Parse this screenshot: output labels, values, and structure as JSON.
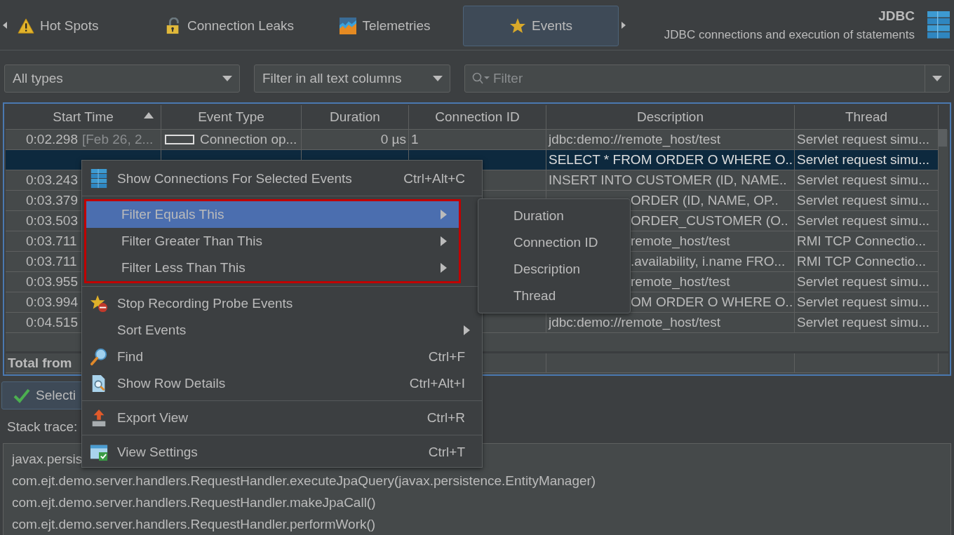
{
  "tabs": [
    {
      "label": "Hot Spots",
      "selected": false
    },
    {
      "label": "Connection Leaks",
      "selected": false
    },
    {
      "label": "Telemetries",
      "selected": false
    },
    {
      "label": "Events",
      "selected": true
    }
  ],
  "header": {
    "title": "JDBC",
    "subtitle": "JDBC connections and execution of statements"
  },
  "filters": {
    "type_dropdown": "All types",
    "column_dropdown": "Filter in all text columns",
    "search": {
      "placeholder": "Filter"
    }
  },
  "table": {
    "columns": [
      {
        "label": "Start Time",
        "sorted": true
      },
      {
        "label": "Event Type",
        "sorted": false
      },
      {
        "label": "Duration",
        "sorted": false
      },
      {
        "label": "Connection ID",
        "sorted": false
      },
      {
        "label": "Description",
        "sorted": false
      },
      {
        "label": "Thread",
        "sorted": false
      }
    ],
    "rows": [
      {
        "start": "0:02.298",
        "date": "[Feb 26, 2...",
        "type": "Connection op...",
        "duration": "0 µs",
        "connection": "1",
        "description": "jdbc:demo://remote_host/test",
        "thread": "Servlet request simu...",
        "selected": false
      },
      {
        "description": "SELECT * FROM ORDER O WHERE O..",
        "thread": "Servlet request simu...",
        "selected": true
      },
      {
        "start": "0:03.243",
        "description": "INSERT INTO CUSTOMER (ID, NAME..",
        "thread": "Servlet request simu...",
        "selected": false
      },
      {
        "start": "0:03.379",
        "description": "ORDER (ID, NAME, OP..",
        "description_covered": true,
        "thread": "Servlet request simu...",
        "selected": false
      },
      {
        "start": "0:03.503",
        "description": "ORDER_CUSTOMER (O..",
        "description_covered": true,
        "thread": "Servlet request simu...",
        "selected": false
      },
      {
        "start": "0:03.711",
        "description": "remote_host/test",
        "description_covered": true,
        "thread": "RMI TCP Connectio...",
        "selected": false
      },
      {
        "start": "0:03.711",
        "description": ".availability, i.name FRO...",
        "description_covered": true,
        "thread": "RMI TCP Connectio...",
        "selected": false
      },
      {
        "start": "0:03.955",
        "description": "remote_host/test",
        "description_covered": true,
        "thread": "Servlet request simu...",
        "selected": false
      },
      {
        "start": "0:03.994",
        "description": "OM ORDER O WHERE O..",
        "description_covered": true,
        "thread": "Servlet request simu...",
        "selected": false
      },
      {
        "start": "0:04.515",
        "description": "jdbc:demo://remote_host/test",
        "thread": "Servlet request simu...",
        "selected": false
      }
    ],
    "total_label": "Total from"
  },
  "selection_button": "Selecti",
  "stack_label": "Stack trace:",
  "stack_lines": [
    "javax.persis",
    "com.ejt.demo.server.handlers.RequestHandler.executeJpaQuery(javax.persistence.EntityManager)",
    "com.ejt.demo.server.handlers.RequestHandler.makeJpaCall()",
    "com.ejt.demo.server.handlers.RequestHandler.performWork()"
  ],
  "context_menu": {
    "sections": [
      {
        "highlighted": false,
        "items": [
          {
            "label": "Show Connections For Selected Events",
            "shortcut": "Ctrl+Alt+C",
            "submenu": false,
            "selected": false
          }
        ]
      },
      {
        "highlighted": true,
        "items": [
          {
            "label": "Filter Equals This",
            "submenu": true,
            "selected": true
          },
          {
            "label": "Filter Greater Than This",
            "submenu": true,
            "selected": false
          },
          {
            "label": "Filter Less Than This",
            "submenu": true,
            "selected": false
          }
        ]
      },
      {
        "highlighted": false,
        "items": [
          {
            "label": "Stop Recording Probe Events",
            "submenu": false,
            "selected": false
          },
          {
            "label": "Sort Events",
            "submenu": true,
            "selected": false
          },
          {
            "label": "Find",
            "shortcut": "Ctrl+F",
            "submenu": false,
            "selected": false
          },
          {
            "label": "Show Row Details",
            "shortcut": "Ctrl+Alt+I",
            "submenu": false,
            "selected": false
          }
        ]
      },
      {
        "highlighted": false,
        "items": [
          {
            "label": "Export View",
            "shortcut": "Ctrl+R",
            "submenu": false,
            "selected": false
          }
        ]
      },
      {
        "highlighted": false,
        "items": [
          {
            "label": "View Settings",
            "shortcut": "Ctrl+T",
            "submenu": false,
            "selected": false
          }
        ]
      }
    ]
  },
  "submenu": [
    "Duration",
    "Connection ID",
    "Description",
    "Thread"
  ]
}
